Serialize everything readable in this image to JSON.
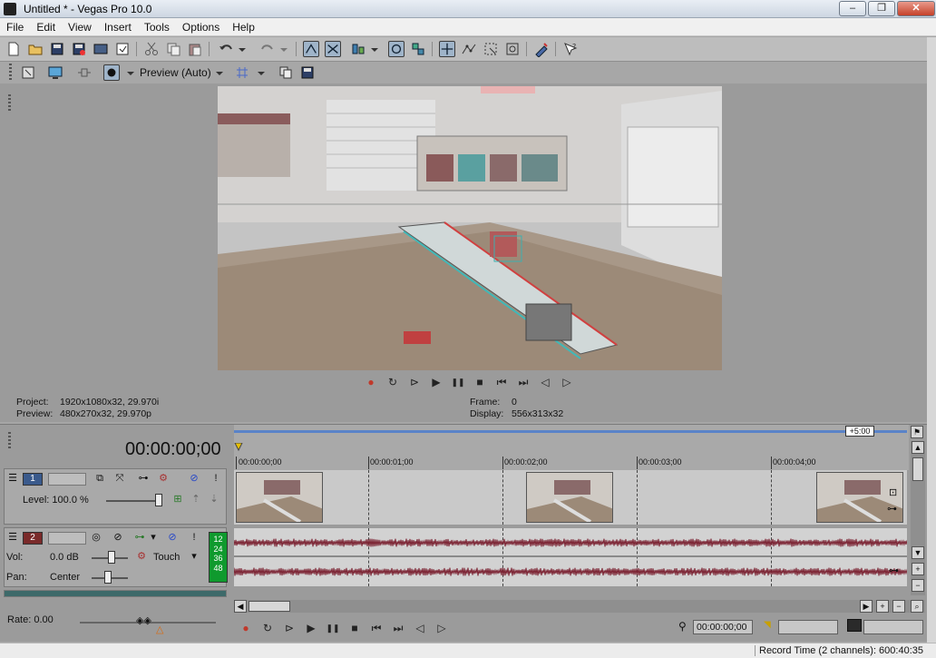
{
  "window": {
    "title": "Untitled * - Vegas Pro 10.0",
    "minimize_glyph": "–",
    "maximize_glyph": "❐",
    "close_glyph": "✕"
  },
  "menu": [
    "File",
    "Edit",
    "View",
    "Insert",
    "Tools",
    "Options",
    "Help"
  ],
  "preview": {
    "quality_label": "Preview (Auto)",
    "project_label": "Project:",
    "project_value": "1920x1080x32, 29.970i",
    "preview_label": "Preview:",
    "preview_value": "480x270x32, 29.970p",
    "frame_label": "Frame:",
    "frame_value": "0",
    "display_label": "Display:",
    "display_value": "556x313x32"
  },
  "timeline": {
    "timecode": "00:00:00;00",
    "marker_label": "+5:00",
    "ruler_labels": [
      "00:00:00;00",
      "00:00:01;00",
      "00:00:02;00",
      "00:00:03;00",
      "00:00:04;00"
    ]
  },
  "tracks": {
    "video": {
      "number": "1",
      "level_label": "Level: 100.0 %",
      "level_fraction": 1.0,
      "color": "#3a5a8c"
    },
    "audio": {
      "number": "2",
      "vol_label": "Vol:",
      "vol_value": "0.0 dB",
      "automation_mode": "Touch",
      "pan_label": "Pan:",
      "pan_value": "Center",
      "meter_labels": [
        "12",
        "24",
        "36",
        "48"
      ],
      "color": "#7a2a2a"
    }
  },
  "bottom": {
    "rate_label": "Rate: 0.00",
    "cursor_time": "00:00:00;00"
  },
  "status": {
    "record_time": "Record Time (2 channels): 600:40:35"
  },
  "icons": {
    "record": "●",
    "loop": "↻",
    "play_from_start": "⊳",
    "play": "▶",
    "pause": "❚❚",
    "stop": "■",
    "go_start": "⏮",
    "go_end": "⏭",
    "prev_frame": "◁",
    "next_frame": "▷"
  },
  "colors": {
    "accent_blue": "#5a83c8",
    "meter_green": "#0f9a2e",
    "waveform": "#7a2030"
  }
}
